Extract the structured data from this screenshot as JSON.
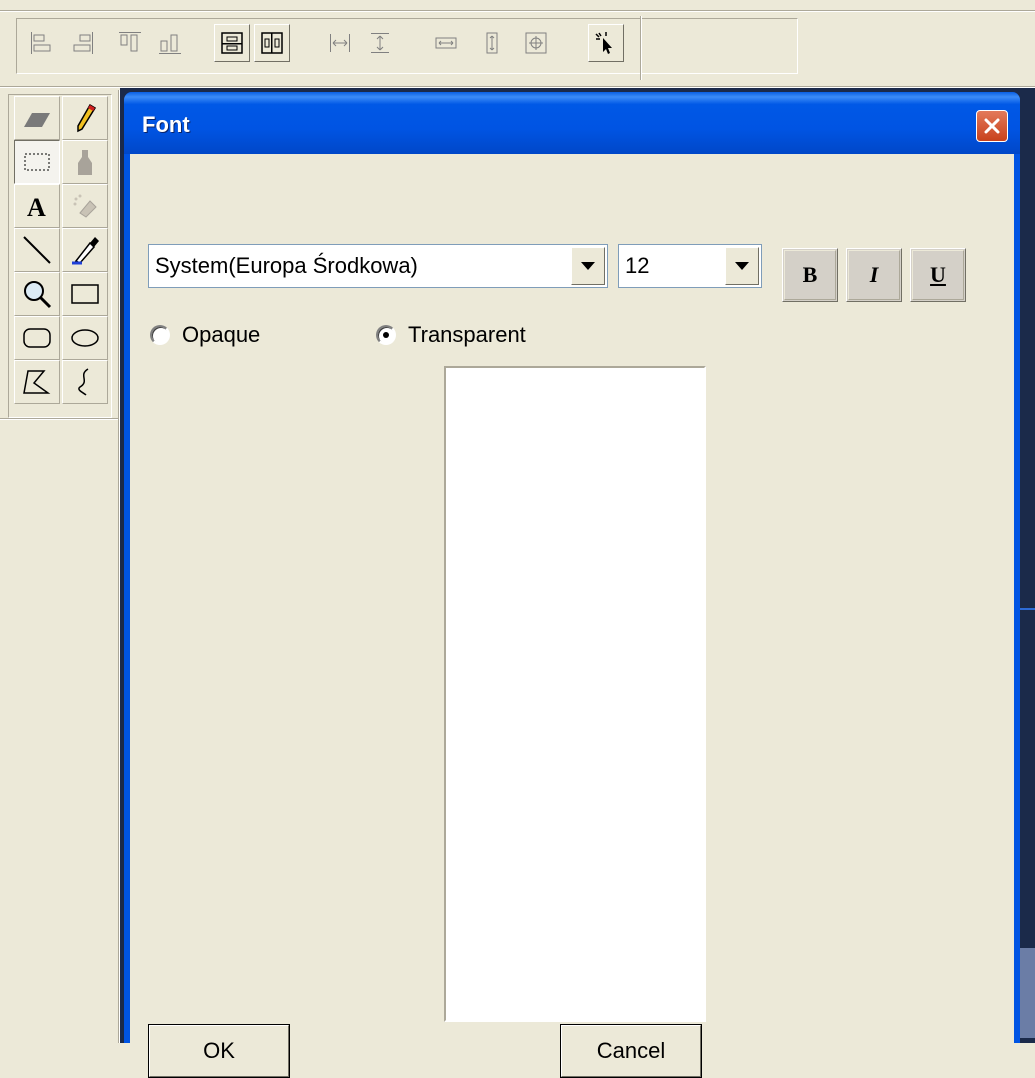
{
  "dialog": {
    "title": "Font",
    "font_name": "System(Europa Środkowa)",
    "font_size": "12",
    "bold_label": "B",
    "italic_label": "I",
    "underline_label": "U",
    "background_options": [
      {
        "label": "Opaque",
        "selected": false
      },
      {
        "label": "Transparent",
        "selected": true
      }
    ],
    "ok_label": "OK",
    "cancel_label": "Cancel"
  },
  "toolbar": {
    "buttons": [
      {
        "icon": "align-left-icon"
      },
      {
        "icon": "align-right-icon"
      },
      {
        "icon": "align-top-icon"
      },
      {
        "icon": "align-bottom-icon"
      },
      {
        "icon": "center-vertical-icon"
      },
      {
        "icon": "center-horizontal-icon"
      },
      {
        "icon": "space-across-icon"
      },
      {
        "icon": "space-down-icon"
      },
      {
        "icon": "same-width-icon"
      },
      {
        "icon": "same-height-icon"
      },
      {
        "icon": "same-size-icon"
      },
      {
        "icon": "pointer-icon"
      }
    ]
  },
  "palette": {
    "tools": [
      {
        "icon": "eraser-icon"
      },
      {
        "icon": "pencil-icon"
      },
      {
        "icon": "select-rectangle-icon",
        "pressed": true
      },
      {
        "icon": "fill-bucket-icon"
      },
      {
        "icon": "text-icon"
      },
      {
        "icon": "airbrush-icon"
      },
      {
        "icon": "line-icon"
      },
      {
        "icon": "color-picker-icon"
      },
      {
        "icon": "magnifier-icon"
      },
      {
        "icon": "rectangle-icon"
      },
      {
        "icon": "rounded-rectangle-icon"
      },
      {
        "icon": "ellipse-icon"
      },
      {
        "icon": "polygon-icon"
      },
      {
        "icon": "curve-icon"
      }
    ]
  },
  "colors": {
    "titlebar": "#0054E3",
    "face": "#ECE9D8",
    "close": "#C8411C"
  }
}
